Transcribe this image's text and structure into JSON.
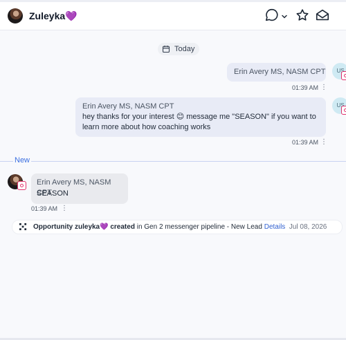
{
  "header": {
    "contact_name": "Zuleyka💜",
    "icons": [
      "chat-bubble-icon",
      "chevron-down-icon",
      "star-icon",
      "mail-open-icon"
    ]
  },
  "date_divider": {
    "label": "Today",
    "icon": "calendar-icon"
  },
  "messages": [
    {
      "direction": "outgoing",
      "sender": "Erin Avery MS, NASM CPT",
      "text": "",
      "time": "01:39 AM",
      "avatar_initials": "US",
      "channel": "instagram"
    },
    {
      "direction": "outgoing",
      "sender": "Erin Avery MS, NASM CPT",
      "text_line1": "hey thanks for your interest 😊 message me \"SEASON\" if you want to",
      "text_line2": "learn more about how coaching works",
      "time": "01:39 AM",
      "avatar_initials": "US",
      "channel": "instagram"
    }
  ],
  "new_divider": {
    "label": "New"
  },
  "incoming": {
    "sender": "Erin Avery MS, NASM CPT",
    "text": "SEASON",
    "time": "01:39 AM",
    "channel": "instagram"
  },
  "activity": {
    "prefix": "Opportunity zuleyka💜 created",
    "middle": " in Gen 2 messenger pipeline - New Lead ",
    "details_link": "Details",
    "date": "Jul 08, 2026"
  },
  "colors": {
    "accent": "#3b6fe0",
    "outgoing_bubble": "#e8ebf6",
    "incoming_bubble": "#e9eaee",
    "instagram": "#e1306c"
  }
}
